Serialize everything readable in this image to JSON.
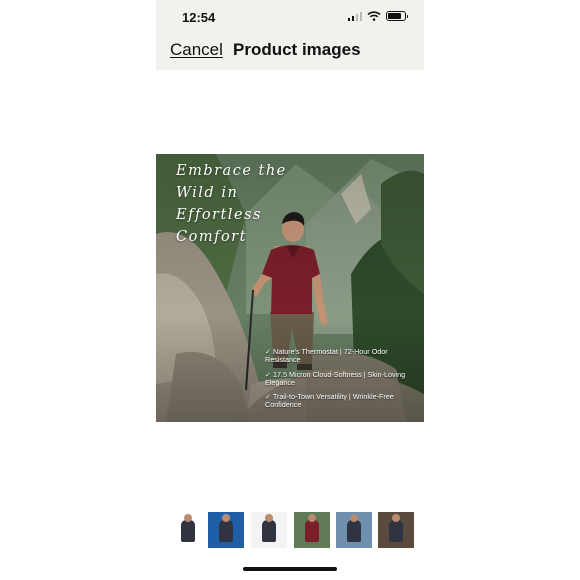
{
  "status_bar": {
    "time": "12:54",
    "icons": [
      "cellular-signal-icon",
      "wifi-icon",
      "battery-icon"
    ],
    "battery_level": 0.8
  },
  "nav": {
    "cancel_label": "Cancel",
    "title": "Product images"
  },
  "hero": {
    "headline_lines": [
      "Embrace the",
      "Wild in",
      "Effortless",
      "Comfort"
    ],
    "features": [
      "✓ Nature’s Thermostat | 72-Hour Odor Resistance",
      "✓ 17.5 Micron Cloud-Softness | Skin-Loving Elegance",
      "✓ Trail-to-Town Versatility | Wrinkle-Free Confidence"
    ]
  },
  "thumbnails": {
    "count": 6,
    "selected_index": 3,
    "items": [
      {
        "name": "thumb-model-front",
        "colors": [
          "#ffffff",
          "#2f3440"
        ]
      },
      {
        "name": "thumb-feature-infographic",
        "colors": [
          "#1f5fa8",
          "#2f3440"
        ]
      },
      {
        "name": "thumb-model-with-badge",
        "colors": [
          "#f3f3f3",
          "#2f3440"
        ]
      },
      {
        "name": "thumb-hiking-scene",
        "colors": [
          "#5f7a55",
          "#7a1f2a"
        ]
      },
      {
        "name": "thumb-outdoor-portrait",
        "colors": [
          "#6f8fae",
          "#2f3440"
        ]
      },
      {
        "name": "thumb-seated-lifestyle",
        "colors": [
          "#5a4a3e",
          "#2f3440"
        ]
      }
    ]
  },
  "colors": {
    "header_bg": "#f2f1ee",
    "text": "#111111",
    "shirt": "#7a1f2a"
  }
}
